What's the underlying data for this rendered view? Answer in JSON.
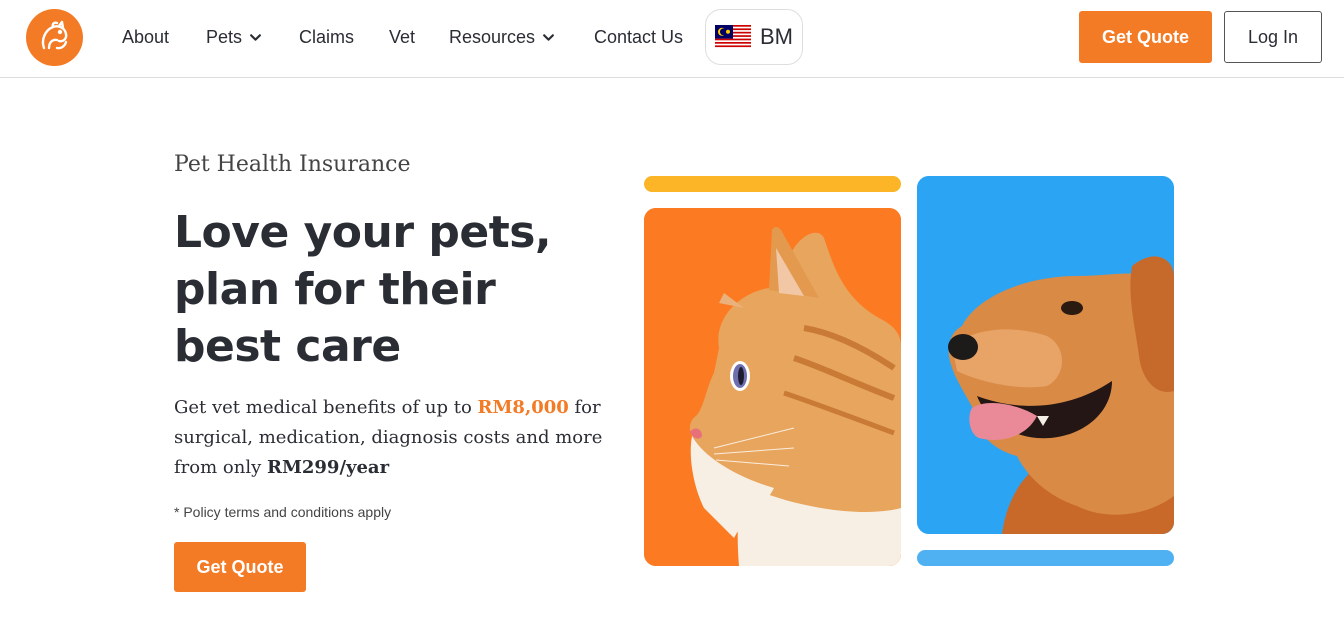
{
  "nav": {
    "items": [
      {
        "label": "About",
        "has_dropdown": false
      },
      {
        "label": "Pets",
        "has_dropdown": true
      },
      {
        "label": "Claims",
        "has_dropdown": false
      },
      {
        "label": "Vet",
        "has_dropdown": false
      },
      {
        "label": "Resources",
        "has_dropdown": true
      },
      {
        "label": "Contact Us",
        "has_dropdown": false
      }
    ],
    "language": {
      "code": "BM",
      "flag": "malaysia-flag-icon"
    },
    "get_quote_label": "Get Quote",
    "login_label": "Log In"
  },
  "hero": {
    "eyebrow": "Pet Health Insurance",
    "headline": "Love your pets, plan for their best care",
    "desc_part1": "Get vet medical benefits of up to ",
    "desc_amount": "RM8,000",
    "desc_part2": " for surgical, medication, diagnosis costs and more from only ",
    "desc_price": "RM299/year",
    "terms": "* Policy terms and conditions apply",
    "cta_label": "Get Quote"
  },
  "colors": {
    "brand_orange": "#f47b25",
    "accent_yellow": "#fbb526",
    "accent_blue": "#4fb1f1",
    "card_cat_bg": "#fb7a22",
    "card_dog_bg": "#2ba5f3"
  }
}
